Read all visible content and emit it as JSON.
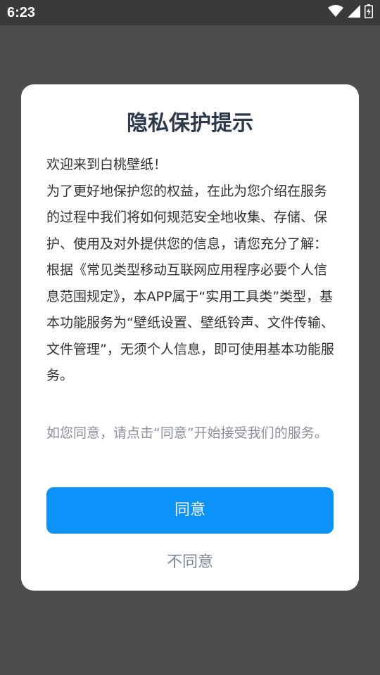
{
  "status_bar": {
    "time": "6:23",
    "icons": [
      "wifi-icon",
      "signal-icon",
      "battery-icon"
    ]
  },
  "dialog": {
    "title": "隐私保护提示",
    "body_paragraphs": [
      "欢迎来到白桃壁纸！",
      "为了更好地保护您的权益，在此为您介绍在服务的过程中我们将如何规范安全地收集、存储、保护、使用及对外提供您的信息，请您充分了解：",
      "根据《常见类型移动互联网应用程序必要个人信息范围规定》，本APP属于“实用工具类”类型，基本功能服务为“壁纸设置、壁纸铃声、文件传输、文件管理”，无须个人信息，即可使用基本功能服务。"
    ],
    "note": "如您同意，请点击“同意”开始接受我们的服务。",
    "agree_label": "同意",
    "disagree_label": "不同意"
  },
  "colors": {
    "accent": "#0b93fb",
    "overlay": "#4d4d4d",
    "title": "#2e3a4b",
    "note": "#8a8f99"
  }
}
